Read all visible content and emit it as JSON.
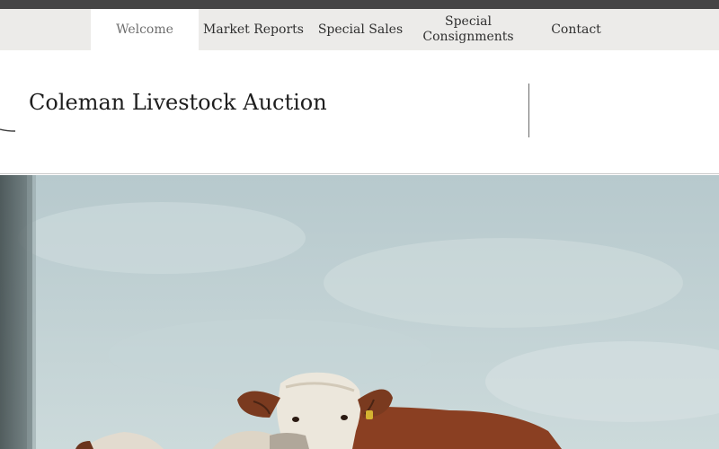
{
  "nav": {
    "items": [
      {
        "label": "Welcome",
        "active": true
      },
      {
        "label": "Market Reports",
        "active": false
      },
      {
        "label": "Special Sales",
        "active": false
      },
      {
        "label": "Special Consignments",
        "active": false
      },
      {
        "label": "Contact",
        "active": false
      }
    ]
  },
  "header": {
    "title": "Coleman Livestock Auction"
  },
  "hero": {
    "subject": "herd of hereford cattle under a cloudy sky"
  },
  "colors": {
    "top_strip": "#454545",
    "nav_background": "#ecebe9",
    "active_tab": "#ffffff",
    "sky": "#c5d4d6",
    "cattle_brown": "#8a3f22"
  }
}
